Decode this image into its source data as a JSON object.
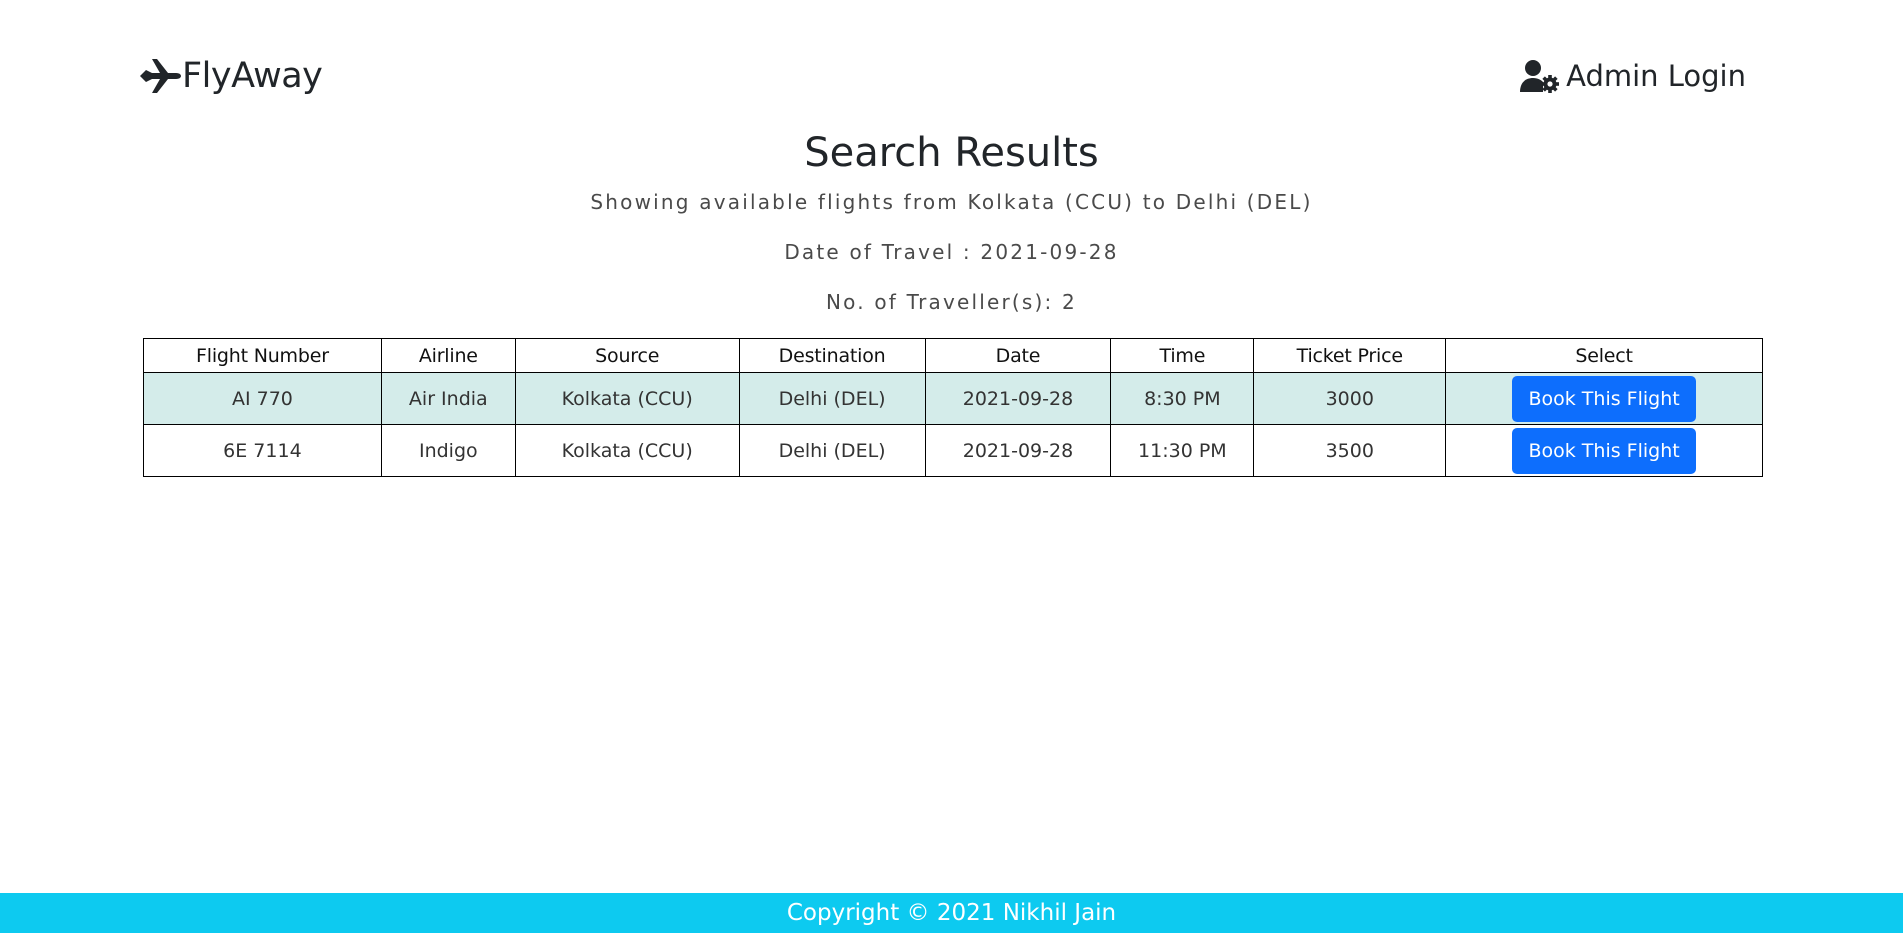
{
  "header": {
    "brand": "FlyAway",
    "brand_icon": "plane-icon",
    "admin_label": "Admin Login",
    "admin_icon": "user-gear-icon"
  },
  "main": {
    "title": "Search Results",
    "route_text": "Showing available flights from Kolkata (CCU) to Delhi (DEL)",
    "date_text": "Date of Travel : 2021-09-28",
    "travellers_text": "No. of Traveller(s): 2"
  },
  "table": {
    "headers": [
      "Flight Number",
      "Airline",
      "Source",
      "Destination",
      "Date",
      "Time",
      "Ticket Price",
      "Select"
    ],
    "rows": [
      {
        "flight_number": "AI 770",
        "airline": "Air India",
        "source": "Kolkata (CCU)",
        "destination": "Delhi (DEL)",
        "date": "2021-09-28",
        "time": "8:30 PM",
        "price": "3000",
        "action": "Book This Flight"
      },
      {
        "flight_number": "6E 7114",
        "airline": "Indigo",
        "source": "Kolkata (CCU)",
        "destination": "Delhi (DEL)",
        "date": "2021-09-28",
        "time": "11:30 PM",
        "price": "3500",
        "action": "Book This Flight"
      }
    ]
  },
  "footer": {
    "text": "Copyright © 2021 Nikhil Jain"
  },
  "colors": {
    "primary_button": "#0d6efd",
    "footer_bg": "#0dcaf0",
    "striped_row": "#d4ecea"
  }
}
